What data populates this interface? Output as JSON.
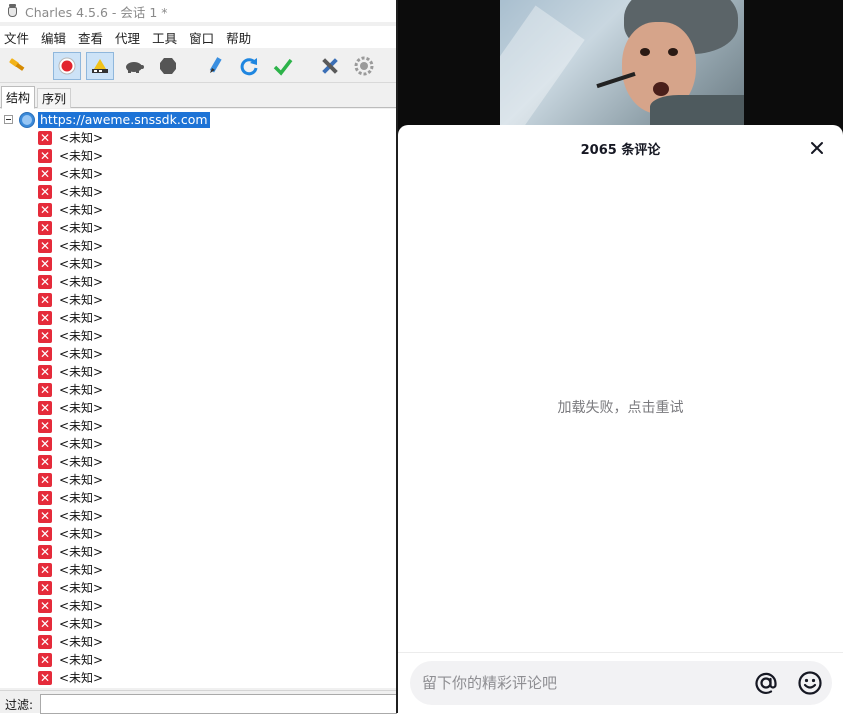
{
  "charles": {
    "window_title": "Charles 4.5.6 - 会话 1 *",
    "menu": [
      "文件",
      "编辑",
      "查看",
      "代理",
      "工具",
      "窗口",
      "帮助"
    ],
    "toolbar_icons": [
      "broom-icon",
      "record-icon",
      "throttle-icon",
      "turtle-icon",
      "stop-icon",
      "pen-icon",
      "refresh-icon",
      "check-icon",
      "tools-icon",
      "settings-icon"
    ],
    "tabs": [
      "结构",
      "序列"
    ],
    "tree": {
      "root_host": "https://aweme.snssdk.com",
      "child_label": "<未知>",
      "child_count": 31
    },
    "filter_label": "过滤:"
  },
  "douyin": {
    "comment_count_title": "2065 条评论",
    "error_message": "加载失败，点击重试",
    "comment_placeholder": "留下你的精彩评论吧",
    "colors": {
      "error": "#e52b3a",
      "selection": "#1d73d6"
    }
  }
}
